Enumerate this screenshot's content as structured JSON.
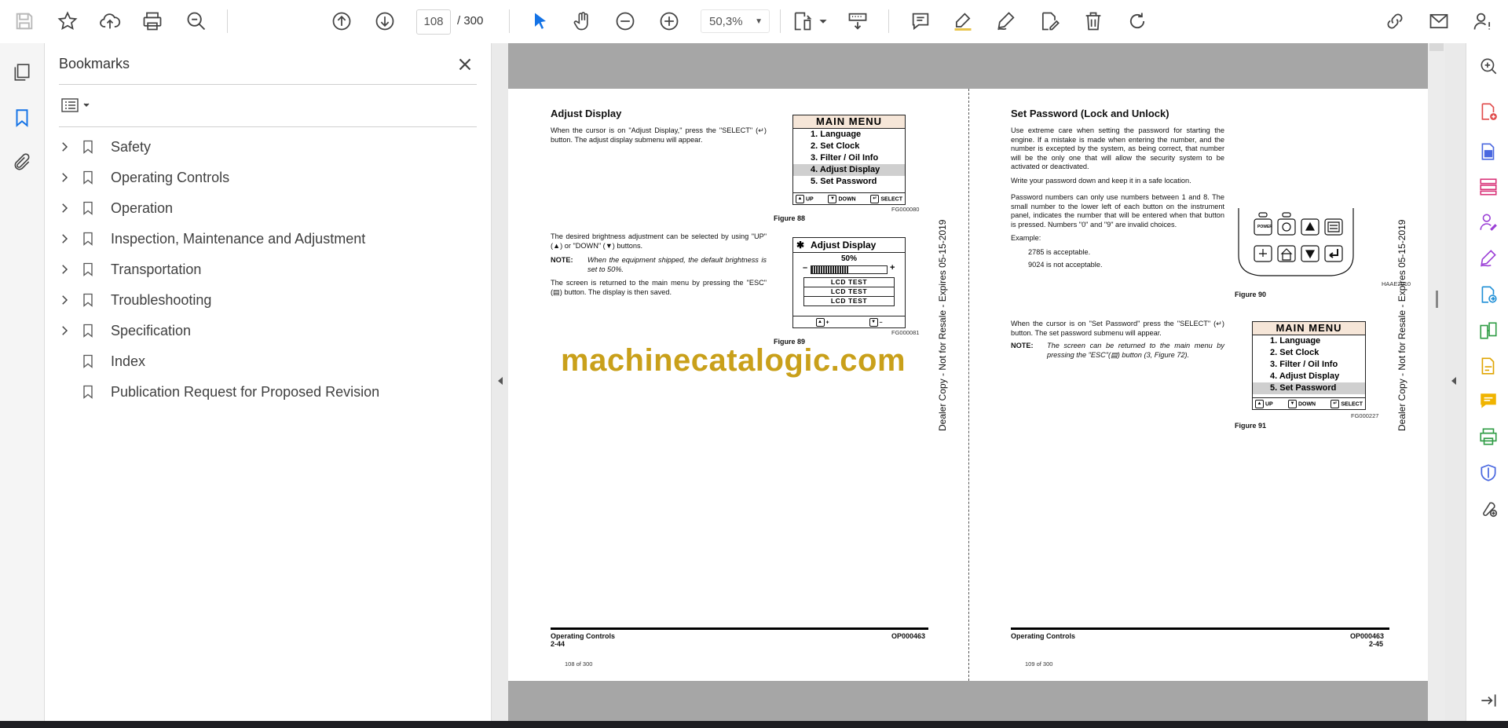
{
  "toolbar": {
    "current_page": "108",
    "page_total": "/  300",
    "zoom": "50,3%",
    "icons": [
      "save-icon",
      "star-icon",
      "upload-cloud-icon",
      "print-icon",
      "zoom-search-icon",
      "page-up-icon",
      "page-down-icon",
      "select-cursor-icon",
      "hand-icon",
      "zoom-out-icon",
      "zoom-in-icon",
      "fit-page-icon",
      "scroll-mode-icon",
      "comment-icon",
      "highlight-icon",
      "draw-icon",
      "edit-text-icon",
      "delete-icon",
      "redo-icon",
      "share-link-icon",
      "email-icon",
      "account-icon"
    ]
  },
  "colors": {
    "accent": "#1473e6",
    "watermark": "#c9a01a",
    "band": "#a6a6a6"
  },
  "bookmarks": {
    "title": "Bookmarks",
    "items": [
      {
        "label": "Safety",
        "expandable": true
      },
      {
        "label": "Operating Controls",
        "expandable": true
      },
      {
        "label": "Operation",
        "expandable": true
      },
      {
        "label": "Inspection, Maintenance and Adjustment",
        "expandable": true
      },
      {
        "label": "Transportation",
        "expandable": true
      },
      {
        "label": "Troubleshooting",
        "expandable": true
      },
      {
        "label": "Specification",
        "expandable": true
      },
      {
        "label": "Index",
        "expandable": false
      },
      {
        "label": "Publication Request for Proposed Revision",
        "expandable": false
      }
    ]
  },
  "doc": {
    "left": {
      "heading": "Adjust Display",
      "p1": "When the cursor is on \"Adjust Display,\" press the \"SELECT\" (↵) button. The adjust display submenu will appear.",
      "menu": {
        "title": "MAIN MENU",
        "items": [
          "1. Language",
          "2. Set Clock",
          "3. Filter / Oil Info",
          "4. Adjust Display",
          "5. Set Password"
        ],
        "foot_up": "UP",
        "foot_down": "DOWN",
        "foot_select": "SELECT"
      },
      "fig88_code": "FG000080",
      "fig88": "Figure 88",
      "p2": "The desired brightness adjustment can be selected by using \"UP\" (▲) or \"DOWN\" (▼) buttons.",
      "note_label": "NOTE:",
      "note_text": "When the equipment shipped, the default brightness is set to 50%.",
      "p3": "The screen is returned to the main menu by pressing the \"ESC\" (▤) button. The display is then saved.",
      "adjust": {
        "title": "Adjust Display",
        "pct": "50%",
        "minus": "–",
        "plus": "+",
        "tests": [
          "LCD TEST",
          "LCD TEST",
          "LCD TEST"
        ],
        "foot_plus": "+",
        "foot_minus": "–"
      },
      "fig89_code": "FG000081",
      "fig89": "Figure 89",
      "footer_section": "Operating Controls",
      "footer_page": "2-44",
      "footer_code": "OP000463",
      "page_of": "108 of 300"
    },
    "right": {
      "heading": "Set Password (Lock and Unlock)",
      "p1": "Use extreme care when setting the password for starting the engine. If a mistake is made when entering the number, and the number is excepted by the system, as being correct, that number will be the only one that will allow the security system to be activated or deactivated.",
      "p2": "Write your password down and keep it in a safe location.",
      "p3": "Password numbers can only use numbers between 1 and 8. The small number to the lower left of each button on the instrument panel, indicates the number that will be entered when that button is pressed. Numbers \"0\" and \"9\" are invalid choices.",
      "example": "Example:",
      "ex1": "2785 is acceptable.",
      "ex2": "9024 is not acceptable.",
      "fig90_code": "HAAE2010",
      "fig90": "Figure 90",
      "p4": "When the cursor is on \"Set Password\" press the \"SELECT\" (↵) button. The set password submenu will appear.",
      "note_label": "NOTE:",
      "note_text": "The screen can be returned to the main menu by pressing the \"ESC\"(▤) button (3, Figure 72).",
      "menu": {
        "title": "MAIN MENU",
        "items": [
          "1. Language",
          "2. Set Clock",
          "3. Filter / Oil Info",
          "4. Adjust Display",
          "5. Set Password"
        ],
        "foot_up": "UP",
        "foot_down": "DOWN",
        "foot_select": "SELECT"
      },
      "fig91_code": "FG000227",
      "fig91": "Figure 91",
      "footer_section": "Operating Controls",
      "footer_page": "2-45",
      "footer_code": "OP000463",
      "page_of": "109 of 300"
    },
    "vertical_stamp": "Dealer Copy - Not for Resale - Expires 05-15-2019",
    "watermark": "machinecatalogic.com"
  }
}
